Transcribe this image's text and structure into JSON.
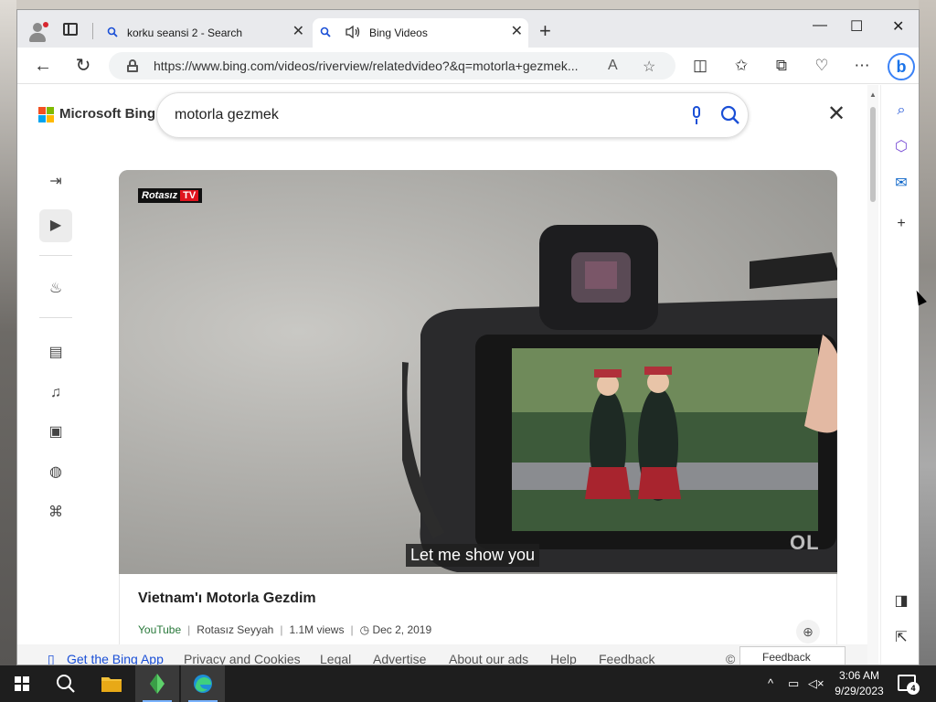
{
  "browser": {
    "tabs": [
      {
        "label": "korku seansi 2 - Search",
        "close": "✕"
      },
      {
        "label": "Bing Videos",
        "close": "✕"
      }
    ],
    "new_tab": "+",
    "window_controls": {
      "minimize": "—",
      "maximize": "☐",
      "close": "✕"
    },
    "url": "https://www.bing.com/videos/riverview/relatedvideo?&q=motorla+gezmek..."
  },
  "bing": {
    "logo_text": "Microsoft Bing",
    "search_value": "motorla gezmek",
    "close": "✕"
  },
  "video": {
    "channel_logo": "Rotasız",
    "channel_logo_tv": "TV",
    "caption": "Let me show you",
    "watermark": "OL",
    "title": "Vietnam'ı Motorla Gezdim",
    "source": "YouTube",
    "channel": "Rotasız Seyyah",
    "views": "1.1M views",
    "date": "Dec 2, 2019"
  },
  "footer": {
    "get_app": "Get the Bing App",
    "privacy": "Privacy and Cookies",
    "legal": "Legal",
    "advertise": "Advertise",
    "about_ads": "About our ads",
    "help": "Help",
    "feedback": "Feedback",
    "copyright": "©",
    "feedback_button": "Feedback"
  },
  "taskbar": {
    "time": "3:06 AM",
    "date": "9/29/2023",
    "notifications": "4"
  }
}
